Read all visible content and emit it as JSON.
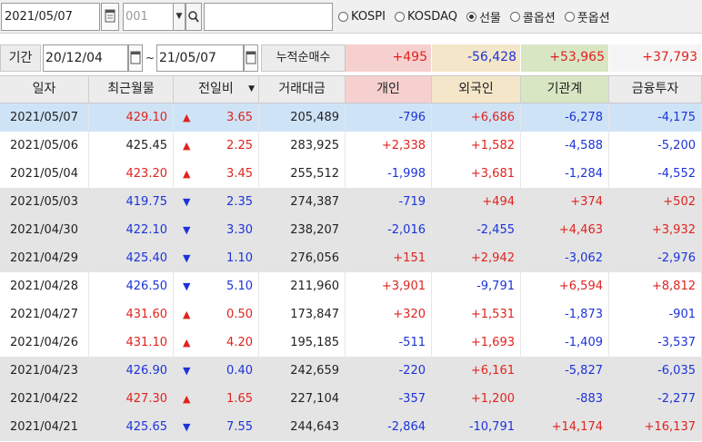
{
  "toolbar": {
    "date": "2021/05/07",
    "code_placeholder": "001",
    "name_value": "",
    "radios": [
      {
        "label": "KOSPI",
        "checked": false
      },
      {
        "label": "KOSDAQ",
        "checked": false
      },
      {
        "label": "선물",
        "checked": true
      },
      {
        "label": "콜옵션",
        "checked": false
      },
      {
        "label": "풋옵션",
        "checked": false
      }
    ]
  },
  "period": {
    "label": "기간",
    "start": "20/12/04",
    "tilde": "~",
    "end": "21/05/07",
    "cum_label": "누적순매수",
    "cum": [
      {
        "value": "+495",
        "tone": "up",
        "bg": "#f6d0cf"
      },
      {
        "value": "-56,428",
        "tone": "dn",
        "bg": "#f4e6c9"
      },
      {
        "value": "+53,965",
        "tone": "up",
        "bg": "#d8e6c4"
      },
      {
        "value": "+37,793",
        "tone": "up",
        "bg": "#f5f5f5"
      }
    ]
  },
  "table": {
    "headers": [
      "일자",
      "최근월물",
      "전일비",
      "거래대금",
      "개인",
      "외국인",
      "기관계",
      "금융투자"
    ],
    "header_bgs": [
      "#ececec",
      "#ececec",
      "#ececec",
      "#ececec",
      "#f6d0cf",
      "#f4e6c9",
      "#d8e6c4",
      "#ececec"
    ],
    "sort_marker": "▼",
    "colors": {
      "up": "#e0231e",
      "down": "#1c33d9",
      "selected": "#cfe3f6",
      "band": "#e4e4e4"
    },
    "rows": [
      {
        "date": "2021/05/07",
        "price": "429.10",
        "ptone": "up",
        "dir": "▲",
        "chg": "3.65",
        "ctone": "up",
        "volume": "205,489",
        "indiv": "-796",
        "foreign": "+6,686",
        "inst": "-6,278",
        "fin": "-4,175",
        "bg": "s"
      },
      {
        "date": "2021/05/06",
        "price": "425.45",
        "ptone": "blk",
        "dir": "▲",
        "chg": "2.25",
        "ctone": "up",
        "volume": "283,925",
        "indiv": "+2,338",
        "foreign": "+1,582",
        "inst": "-4,588",
        "fin": "-5,200",
        "bg": "w"
      },
      {
        "date": "2021/05/04",
        "price": "423.20",
        "ptone": "up",
        "dir": "▲",
        "chg": "3.45",
        "ctone": "up",
        "volume": "255,512",
        "indiv": "-1,998",
        "foreign": "+3,681",
        "inst": "-1,284",
        "fin": "-4,552",
        "bg": "w"
      },
      {
        "date": "2021/05/03",
        "price": "419.75",
        "ptone": "dn",
        "dir": "▼",
        "chg": "2.35",
        "ctone": "dn",
        "volume": "274,387",
        "indiv": "-719",
        "foreign": "+494",
        "inst": "+374",
        "fin": "+502",
        "bg": "g"
      },
      {
        "date": "2021/04/30",
        "price": "422.10",
        "ptone": "dn",
        "dir": "▼",
        "chg": "3.30",
        "ctone": "dn",
        "volume": "238,207",
        "indiv": "-2,016",
        "foreign": "-2,455",
        "inst": "+4,463",
        "fin": "+3,932",
        "bg": "g"
      },
      {
        "date": "2021/04/29",
        "price": "425.40",
        "ptone": "dn",
        "dir": "▼",
        "chg": "1.10",
        "ctone": "dn",
        "volume": "276,056",
        "indiv": "+151",
        "foreign": "+2,942",
        "inst": "-3,062",
        "fin": "-2,976",
        "bg": "g"
      },
      {
        "date": "2021/04/28",
        "price": "426.50",
        "ptone": "dn",
        "dir": "▼",
        "chg": "5.10",
        "ctone": "dn",
        "volume": "211,960",
        "indiv": "+3,901",
        "foreign": "-9,791",
        "inst": "+6,594",
        "fin": "+8,812",
        "bg": "w"
      },
      {
        "date": "2021/04/27",
        "price": "431.60",
        "ptone": "up",
        "dir": "▲",
        "chg": "0.50",
        "ctone": "up",
        "volume": "173,847",
        "indiv": "+320",
        "foreign": "+1,531",
        "inst": "-1,873",
        "fin": "-901",
        "bg": "w"
      },
      {
        "date": "2021/04/26",
        "price": "431.10",
        "ptone": "up",
        "dir": "▲",
        "chg": "4.20",
        "ctone": "up",
        "volume": "195,185",
        "indiv": "-511",
        "foreign": "+1,693",
        "inst": "-1,409",
        "fin": "-3,537",
        "bg": "w"
      },
      {
        "date": "2021/04/23",
        "price": "426.90",
        "ptone": "dn",
        "dir": "▼",
        "chg": "0.40",
        "ctone": "dn",
        "volume": "242,659",
        "indiv": "-220",
        "foreign": "+6,161",
        "inst": "-5,827",
        "fin": "-6,035",
        "bg": "g"
      },
      {
        "date": "2021/04/22",
        "price": "427.30",
        "ptone": "up",
        "dir": "▲",
        "chg": "1.65",
        "ctone": "up",
        "volume": "227,104",
        "indiv": "-357",
        "foreign": "+1,200",
        "inst": "-883",
        "fin": "-2,277",
        "bg": "g"
      },
      {
        "date": "2021/04/21",
        "price": "425.65",
        "ptone": "dn",
        "dir": "▼",
        "chg": "7.55",
        "ctone": "dn",
        "volume": "244,643",
        "indiv": "-2,864",
        "foreign": "-10,791",
        "inst": "+14,174",
        "fin": "+16,137",
        "bg": "g"
      }
    ]
  }
}
